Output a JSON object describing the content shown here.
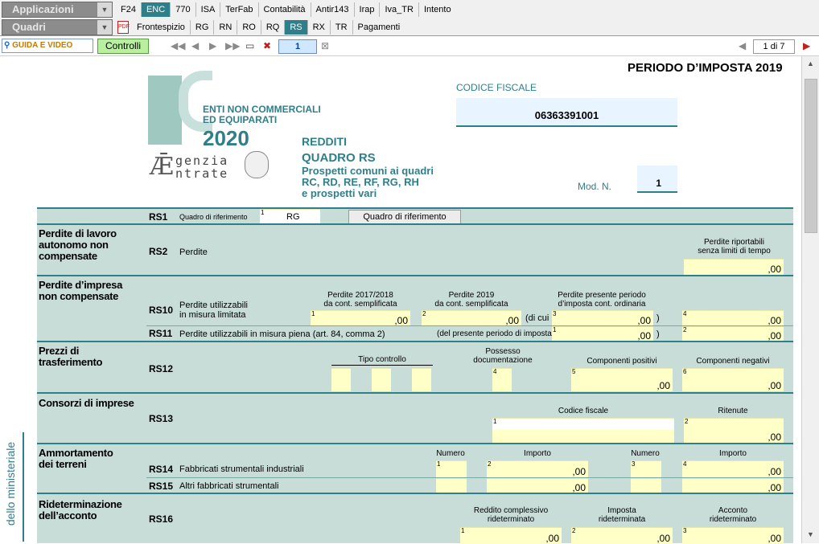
{
  "toolbar": {
    "applicazioni": "Applicazioni",
    "quadri": "Quadri",
    "app_tabs": [
      "F24",
      "ENC",
      "770",
      "ISA",
      "TerFab",
      "Contabilità",
      "Antir143",
      "Irap",
      "Iva_TR",
      "Intento"
    ],
    "quadri_tabs": [
      "Frontespizio",
      "RG",
      "RN",
      "RO",
      "RQ",
      "RS",
      "RX",
      "TR",
      "Pagamenti"
    ],
    "guida": "GUIDA E VIDEO",
    "controlli": "Controlli",
    "page_current": "1",
    "page_count": "1 di 7"
  },
  "header": {
    "periodo": "PERIODO D’IMPOSTA 2019",
    "logo_line1": "ENTI NON COMMERCIALI",
    "logo_line2": "ED EQUIPARATI",
    "logo_year": "2020",
    "agenzia1": "genzia",
    "agenzia2": "ntrate",
    "codice_fiscale_label": "CODICE FISCALE",
    "codice_fiscale": "06363391001",
    "redditi": "REDDITI",
    "quadro": "QUADRO RS",
    "desc1": "Prospetti comuni ai quadri",
    "desc2": "RC, RD, RE, RF, RG, RH",
    "desc3": "e prospetti vari",
    "modn_label": "Mod. N.",
    "modn": "1"
  },
  "form": {
    "rs1": {
      "code": "RS1",
      "label": "Quadro di riferimento",
      "num": "1",
      "value": "RG",
      "button": "Quadro di riferimento"
    },
    "sec_perdite_lavoro": [
      "Perdite di lavoro",
      "autonomo non",
      "compensate"
    ],
    "rs2": {
      "code": "RS2",
      "label": "Perdite",
      "col": "Perdite riportabili",
      "col2": "senza limiti di tempo",
      "value": ",00"
    },
    "sec_perdite_impresa": [
      "Perdite d’impresa",
      "non compensate"
    ],
    "rs10": {
      "code": "RS10",
      "label1": "Perdite utilizzabili",
      "label2": "in misura limitata",
      "c1a": "Perdite 2017/2018",
      "c1b": "da cont. semplificata",
      "c2a": "Perdite 2019",
      "c2b": "da cont. semplificata",
      "c3a": "Perdite presente periodo",
      "c3b": "d’imposta cont. ordinaria",
      "dicui": "(di cui",
      "paren": ")",
      "v1": ",00",
      "v2": ",00",
      "v3": ",00",
      "v4": ",00"
    },
    "rs11": {
      "code": "RS11",
      "label": "Perdite utilizzabili in misura piena (art. 84, comma 2)",
      "label2": "(del presente periodo di imposta",
      "paren": ")",
      "v1": ",00",
      "v2": ",00"
    },
    "sec_prezzi": [
      "Prezzi di",
      "trasferimento"
    ],
    "rs12": {
      "code": "RS12",
      "tipo": "Tipo controllo",
      "possesso1": "Possesso",
      "possesso2": "documentazione",
      "positivi": "Componenti positivi",
      "negativi": "Componenti negativi",
      "v5": ",00",
      "v6": ",00"
    },
    "sec_consorzi": "Consorzi di imprese",
    "rs13": {
      "code": "RS13",
      "cf": "Codice fiscale",
      "ritenute": "Ritenute",
      "v2": ",00"
    },
    "sec_ammortamento": [
      "Ammortamento",
      "dei terreni"
    ],
    "rs14": {
      "code": "RS14",
      "label": "Fabbricati strumentali industriali",
      "numero": "Numero",
      "importo": "Importo",
      "v2": ",00",
      "v4": ",00"
    },
    "rs15": {
      "code": "RS15",
      "label": "Altri fabbricati strumentali",
      "v2": ",00",
      "v4": ",00"
    },
    "sec_rideterminazione": [
      "Rideterminazione",
      "dell’acconto"
    ],
    "rs16": {
      "code": "RS16",
      "c1a": "Reddito complessivo",
      "c1b": "rideterminato",
      "c2a": "Imposta",
      "c2b": "rideterminata",
      "c3a": "Acconto",
      "c3b": "rideterminato",
      "v1": ",00",
      "v2": ",00",
      "v3": ",00"
    },
    "side_text": "dello ministeriale"
  },
  "colors": {
    "accent": "#2f7f8a",
    "band": "#c8dcd8",
    "field": "#ffffc8"
  }
}
